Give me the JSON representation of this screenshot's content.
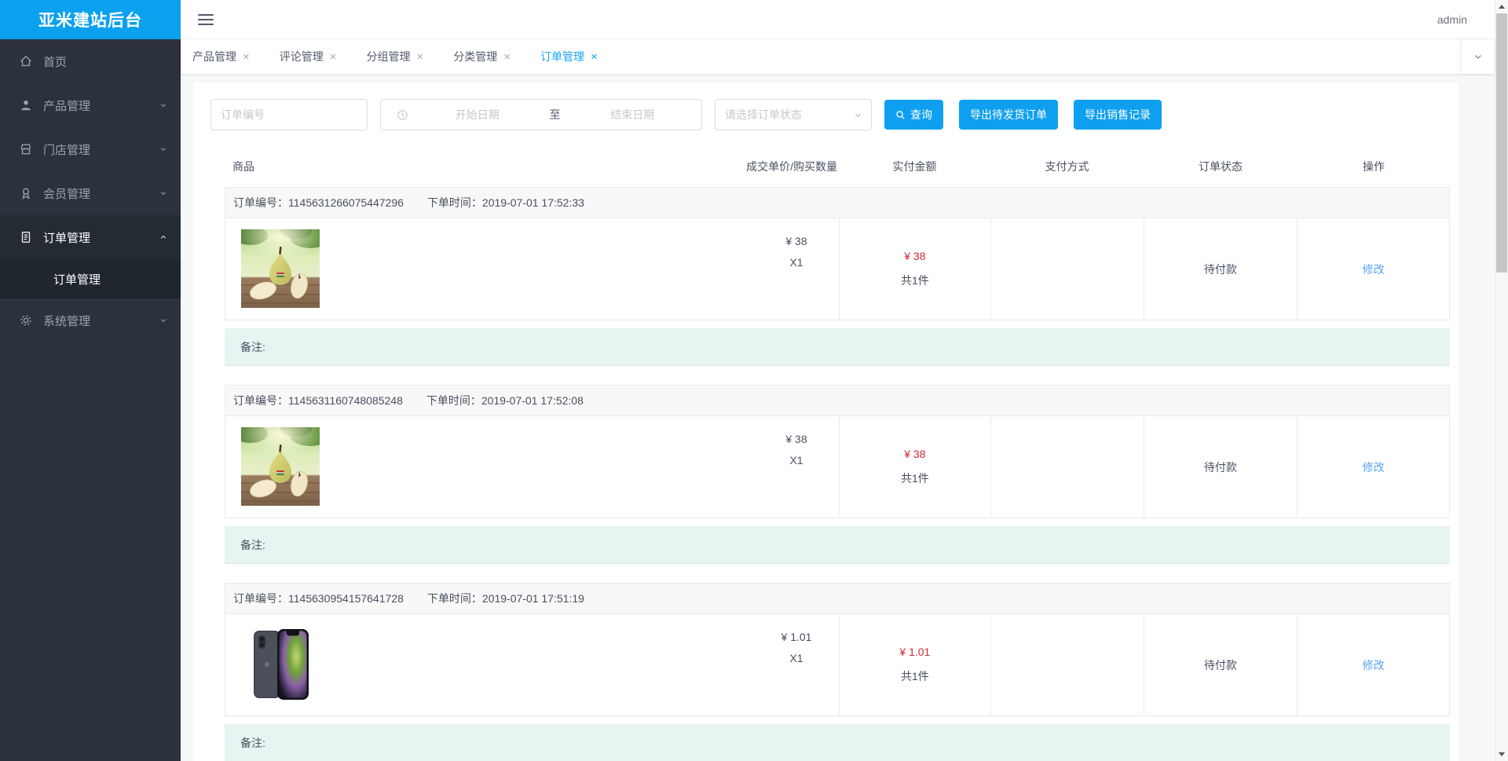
{
  "app": {
    "logo_title": "亚米建站后台",
    "username": "admin"
  },
  "colors": {
    "primary_blue": "#0f9ff0",
    "logo_blue": "#0ca1ee",
    "active_tab_blue": "#18a3f5",
    "link_blue": "#57a3f3",
    "price_red": "#cb2a33",
    "remark_bg": "#e7f4f1",
    "sidebar_bg": "#2b323c",
    "sidebar_open_bg": "#252b33"
  },
  "sidebar": {
    "items": [
      {
        "icon": "home-icon",
        "label": "首页",
        "expandable": false
      },
      {
        "icon": "user-icon",
        "label": "产品管理",
        "expandable": true
      },
      {
        "icon": "store-icon",
        "label": "门店管理",
        "expandable": true
      },
      {
        "icon": "member-icon",
        "label": "会员管理",
        "expandable": true
      },
      {
        "icon": "order-icon",
        "label": "订单管理",
        "expandable": true,
        "expanded": true,
        "children": [
          {
            "label": "订单管理",
            "active": true
          }
        ]
      },
      {
        "icon": "gear-icon",
        "label": "系统管理",
        "expandable": true
      }
    ]
  },
  "tabbar": {
    "close_glyph": "×",
    "tabs": [
      {
        "label": "产品管理"
      },
      {
        "label": "评论管理"
      },
      {
        "label": "分组管理"
      },
      {
        "label": "分类管理"
      },
      {
        "label": "订单管理",
        "active": true
      }
    ]
  },
  "filters": {
    "order_no_placeholder": "订单编号",
    "start_date_placeholder": "开始日期",
    "date_separator": "至",
    "end_date_placeholder": "结束日期",
    "status_placeholder": "请选择订单状态",
    "search_button": "查询",
    "export_pending_button": "导出待发货订单",
    "export_sales_button": "导出销售记录"
  },
  "table": {
    "headers": [
      "商品",
      "成交单价/购买数量",
      "实付金额",
      "支付方式",
      "订单状态",
      "操作"
    ]
  },
  "orders": [
    {
      "order_no_label": "订单编号：",
      "order_no": "1145631266075447296",
      "time_label": "下单时间：",
      "time": "2019-07-01 17:52:33",
      "product_image": "pears-photo",
      "unit_price": "¥ 38",
      "quantity": "X1",
      "paid_amount": "¥ 38",
      "total_count": "共1件",
      "payment_method": "",
      "status": "待付款",
      "action": "修改",
      "remark_label": "备注:",
      "remark": ""
    },
    {
      "order_no_label": "订单编号：",
      "order_no": "1145631160748085248",
      "time_label": "下单时间：",
      "time": "2019-07-01 17:52:08",
      "product_image": "pears-photo",
      "unit_price": "¥ 38",
      "quantity": "X1",
      "paid_amount": "¥ 38",
      "total_count": "共1件",
      "payment_method": "",
      "status": "待付款",
      "action": "修改",
      "remark_label": "备注:",
      "remark": ""
    },
    {
      "order_no_label": "订单编号：",
      "order_no": "1145630954157641728",
      "time_label": "下单时间：",
      "time": "2019-07-01 17:51:19",
      "product_image": "iphone-photo",
      "unit_price": "¥ 1.01",
      "quantity": "X1",
      "paid_amount": "¥ 1.01",
      "total_count": "共1件",
      "payment_method": "",
      "status": "待付款",
      "action": "修改",
      "remark_label": "备注:",
      "remark": ""
    }
  ]
}
